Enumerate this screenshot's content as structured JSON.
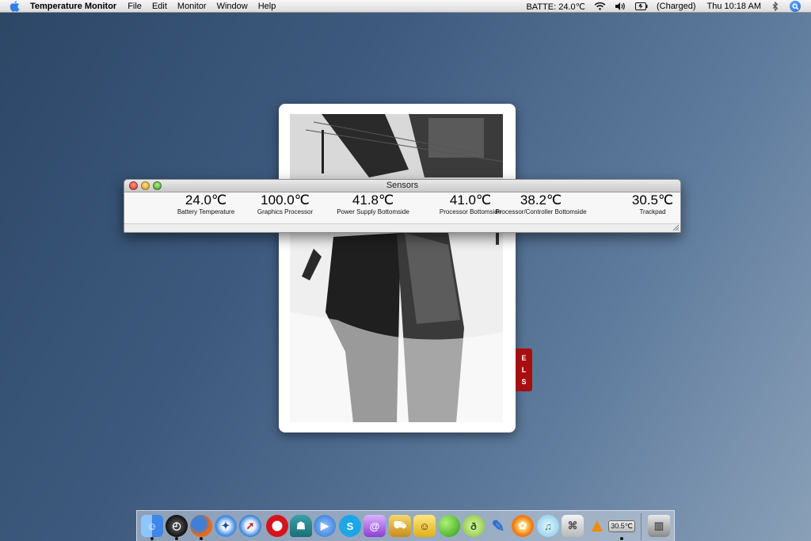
{
  "menubar": {
    "app_name": "Temperature Monitor",
    "items": [
      "File",
      "Edit",
      "Monitor",
      "Window",
      "Help"
    ],
    "battery_temp": "BATTE:  24.0℃",
    "power_status": "(Charged)",
    "clock": "Thu 10:18 AM"
  },
  "window": {
    "title": "Sensors",
    "sensors": [
      {
        "value": "24.0℃",
        "label": "Battery Temperature"
      },
      {
        "value": "100.0℃",
        "label": "Graphics Processor"
      },
      {
        "value": "41.8℃",
        "label": "Power Supply Bottomside"
      },
      {
        "value": "41.0℃",
        "label": "Processor Bottomside"
      },
      {
        "value": "38.2℃",
        "label": "Processor/Controller Bottomside"
      },
      {
        "value": "30.5℃",
        "label": "Trackpad"
      }
    ]
  },
  "widget": {
    "tag_letters": [
      "E",
      "L",
      "S"
    ]
  },
  "dock": {
    "icons": [
      "finder-icon",
      "dashboard-icon",
      "firefox-icon",
      "network-icon",
      "safari-icon",
      "opera-icon",
      "automator-icon",
      "ichat-icon",
      "skype-icon",
      "textedit-icon",
      "transmit-icon",
      "adium-icon",
      "limewire-icon",
      "dreamweaver-icon",
      "feather-icon",
      "flower-icon",
      "itunes-icon",
      "mac-icon",
      "vlc-icon",
      "temperature-monitor-icon",
      "trash-icon"
    ],
    "temp_badge": "30.5℃"
  }
}
